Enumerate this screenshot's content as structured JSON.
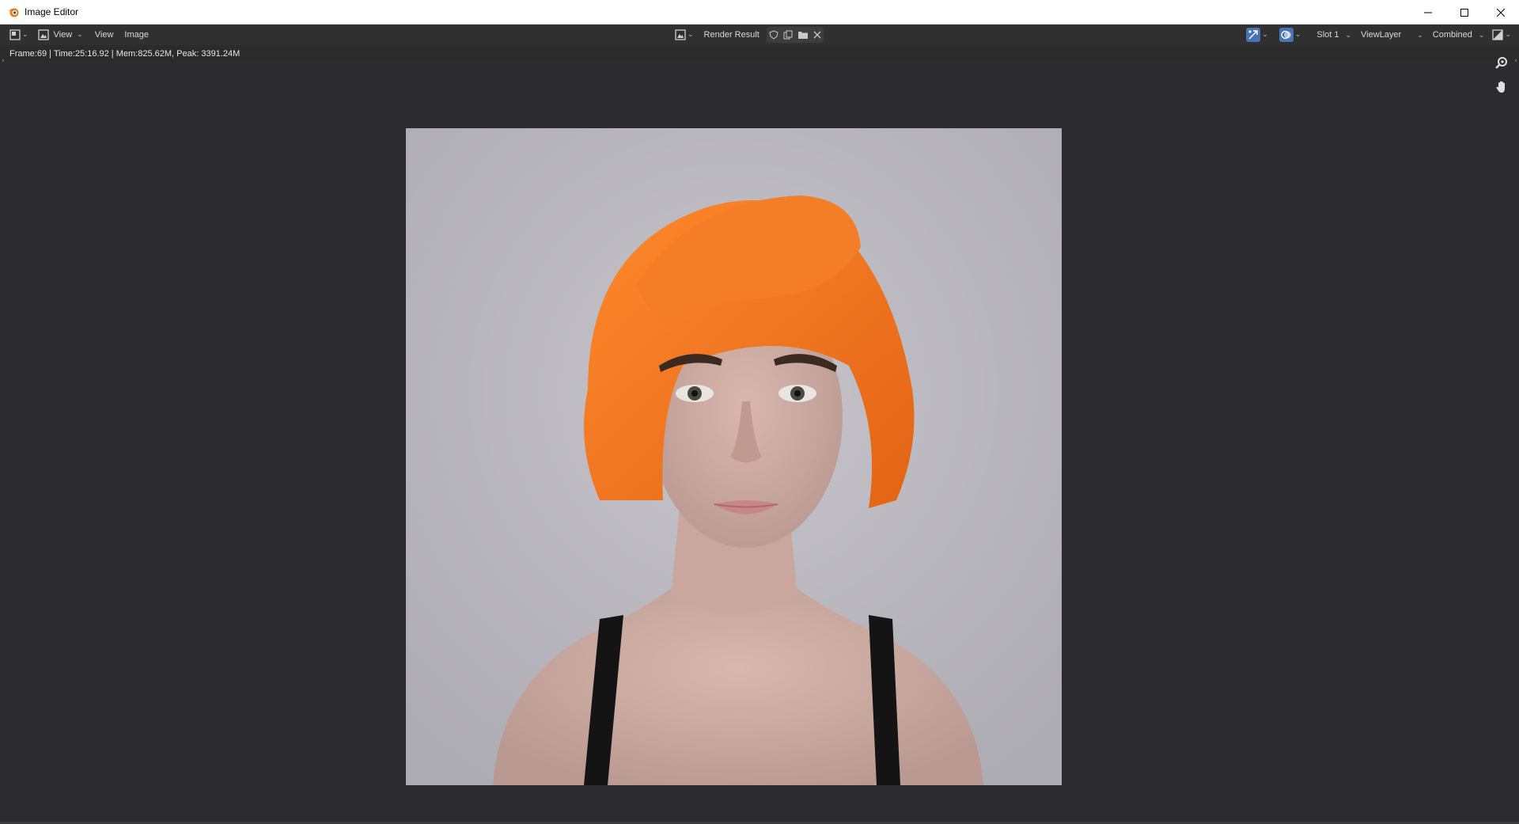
{
  "window": {
    "title": "Image Editor",
    "controls": [
      "minimize-icon",
      "maximize-icon",
      "close-icon"
    ]
  },
  "header": {
    "editor_type_icon": "image-editor-icon",
    "mode_icon": "view-mode-icon",
    "mode_label": "View",
    "menus": [
      "View",
      "Image"
    ],
    "image_browse_icon": "image-browse-icon",
    "image_name": "Render Result",
    "image_actions": [
      "fake-user-shield-icon",
      "duplicate-image-icon",
      "open-image-icon",
      "unlink-close-icon"
    ],
    "gizmo_toggle_icon": "gizmo-toggle-icon",
    "overlay_toggle_icon": "overlay-toggle-icon",
    "slot": "Slot 1",
    "view_layer": "ViewLayer",
    "pass": "Combined",
    "display_channels_icon": "display-channels-icon"
  },
  "status": {
    "text": "Frame:69 | Time:25:16.92 | Mem:825.62M, Peak: 3391.24M"
  },
  "viewport": {
    "nav_gizmos": [
      "zoom-icon",
      "pan-hand-icon"
    ]
  },
  "colors": {
    "background": "#2c2c2e",
    "header": "#303030",
    "render_background": "#b6b4ba",
    "hair": "#f07a2a",
    "accent_blue": "#4772b3"
  }
}
